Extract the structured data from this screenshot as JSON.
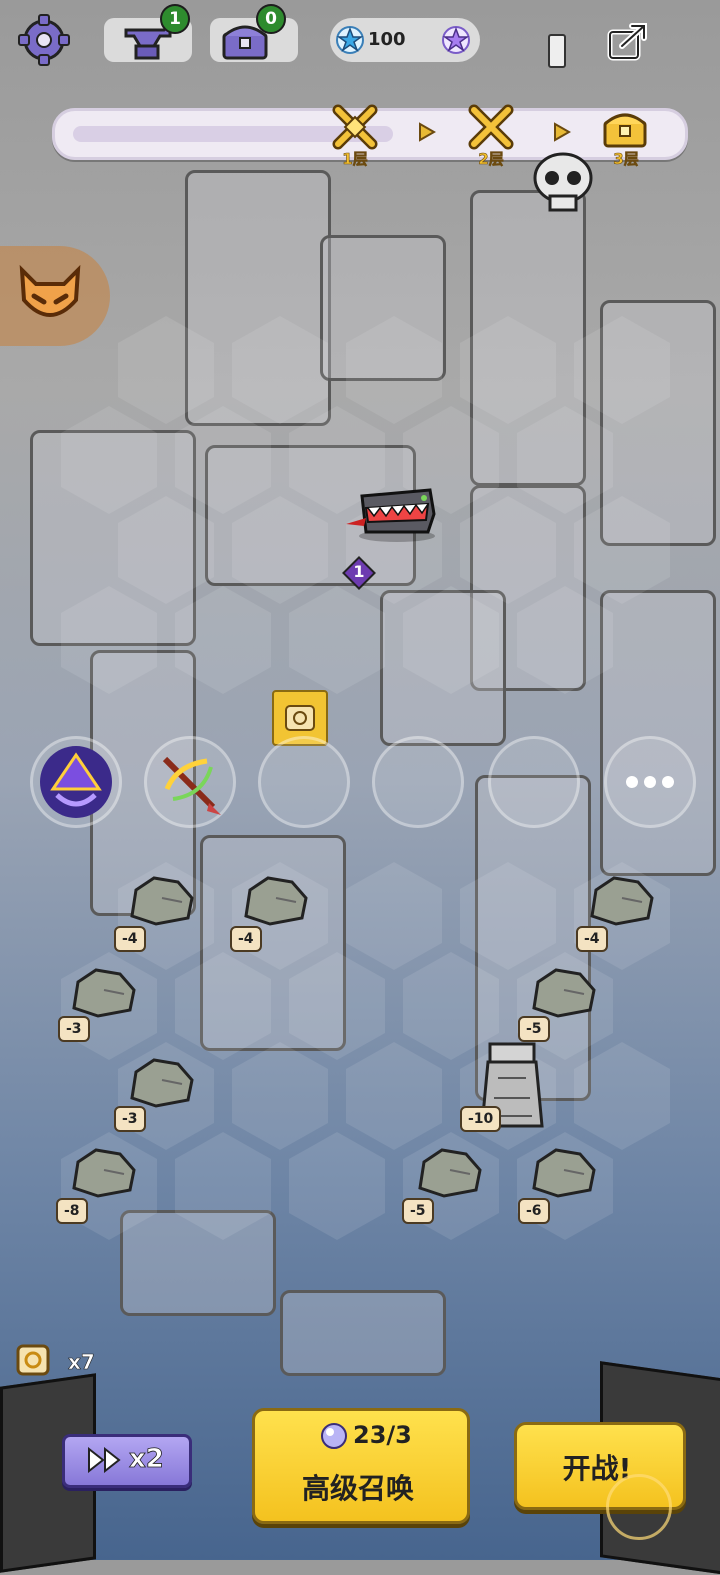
{
  "topbar": {
    "anvil_count": "1",
    "chest_count": "0",
    "stars": "100"
  },
  "floor_progress": {
    "floors": [
      "1层",
      "2层",
      "3层"
    ]
  },
  "battle": {
    "enemy_level": "1"
  },
  "rocks": [
    "-4",
    "-4",
    "-4",
    "-3",
    "-5",
    "-3",
    "-10",
    "-8",
    "-5",
    "-6"
  ],
  "bottom": {
    "scroll_count": "x7",
    "speed_label": "x2",
    "summon_counter": "23/3",
    "summon_label": "高级召唤",
    "start_label": "开战!"
  }
}
